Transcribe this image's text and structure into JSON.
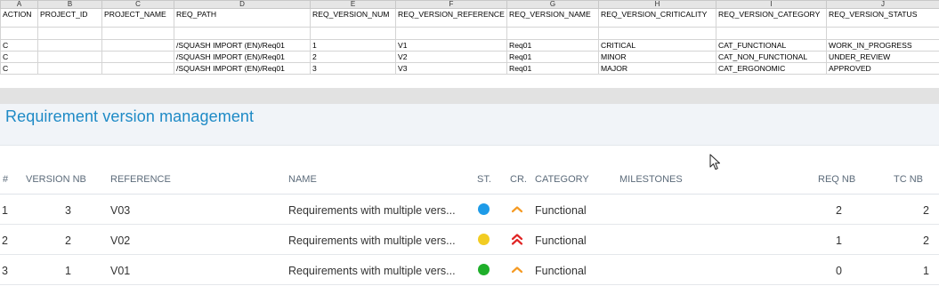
{
  "spreadsheet": {
    "column_letters": [
      "A",
      "B",
      "C",
      "D",
      "E",
      "F",
      "G",
      "H",
      "I",
      "J"
    ],
    "headers": [
      "ACTION",
      "PROJECT_ID",
      "PROJECT_NAME",
      "REQ_PATH",
      "REQ_VERSION_NUM",
      "REQ_VERSION_REFERENCE",
      "REQ_VERSION_NAME",
      "REQ_VERSION_CRITICALITY",
      "REQ_VERSION_CATEGORY",
      "REQ_VERSION_STATUS"
    ],
    "rows": [
      [
        "C",
        "",
        "",
        "/SQUASH IMPORT (EN)/Req01",
        "1",
        "V1",
        "Req01",
        "CRITICAL",
        "CAT_FUNCTIONAL",
        "WORK_IN_PROGRESS"
      ],
      [
        "C",
        "",
        "",
        "/SQUASH IMPORT (EN)/Req01",
        "2",
        "V2",
        "Req01",
        "MINOR",
        "CAT_NON_FUNCTIONAL",
        "UNDER_REVIEW"
      ],
      [
        "C",
        "",
        "",
        "/SQUASH IMPORT (EN)/Req01",
        "3",
        "V3",
        "Req01",
        "MAJOR",
        "CAT_ERGONOMIC",
        "APPROVED"
      ]
    ]
  },
  "panel": {
    "title": "Requirement version management",
    "columns": {
      "index": "#",
      "version_nb": "VERSION NB",
      "reference": "REFERENCE",
      "name": "NAME",
      "status": "ST.",
      "criticality": "CR.",
      "category": "CATEGORY",
      "milestones": "MILESTONES",
      "req_nb": "REQ NB",
      "tc_nb": "TC NB"
    },
    "rows": [
      {
        "index": "1",
        "version_nb": "3",
        "reference": "V03",
        "name": "Requirements with multiple vers...",
        "status_color": "#1e9be8",
        "criticality": "minor",
        "category": "Functional",
        "milestones": "",
        "req_nb": "2",
        "tc_nb": "2"
      },
      {
        "index": "2",
        "version_nb": "2",
        "reference": "V02",
        "name": "Requirements with multiple vers...",
        "status_color": "#f2cc22",
        "criticality": "critical",
        "category": "Functional",
        "milestones": "",
        "req_nb": "1",
        "tc_nb": "2"
      },
      {
        "index": "3",
        "version_nb": "1",
        "reference": "V01",
        "name": "Requirements with multiple vers...",
        "status_color": "#1faf2a",
        "criticality": "minor",
        "category": "Functional",
        "milestones": "",
        "req_nb": "0",
        "tc_nb": "1"
      }
    ]
  },
  "colors": {
    "title_blue": "#1e8ac6",
    "criticality_minor": "#f59a23",
    "criticality_critical": "#e02525"
  },
  "icons": {
    "criticality_minor": "chevron-up-icon",
    "criticality_critical": "double-chevron-up-icon",
    "cursor": "mouse-pointer-icon"
  }
}
